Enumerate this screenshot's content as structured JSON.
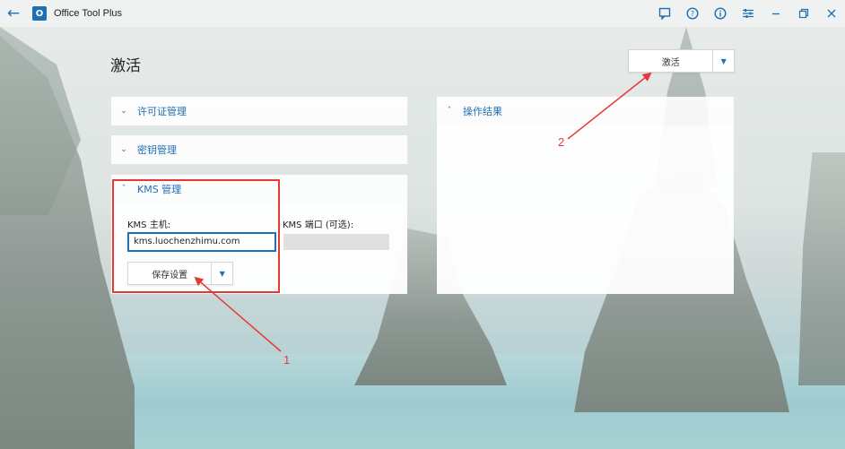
{
  "window": {
    "title": "Office Tool Plus",
    "icons": [
      "back-arrow-icon",
      "app-logo-icon",
      "feedback-icon",
      "help-icon",
      "info-icon",
      "settings-icon",
      "minimize-icon",
      "restore-icon",
      "close-icon"
    ]
  },
  "page": {
    "title": "激活"
  },
  "activate_button": {
    "label": "激活"
  },
  "panels": {
    "license": {
      "label": "许可证管理",
      "expanded": false
    },
    "key": {
      "label": "密钥管理",
      "expanded": false
    },
    "kms": {
      "label": "KMS 管理",
      "expanded": true,
      "host_label": "KMS 主机:",
      "host_value": "kms.luochenzhimu.com",
      "port_label": "KMS 端口 (可选):",
      "port_value": "",
      "save_label": "保存设置"
    },
    "result": {
      "label": "操作结果",
      "expanded": true
    }
  },
  "annotations": {
    "one": "1",
    "two": "2",
    "color": "#e53935"
  },
  "colors": {
    "accent": "#1f6fb5",
    "highlight": "#e53935"
  }
}
